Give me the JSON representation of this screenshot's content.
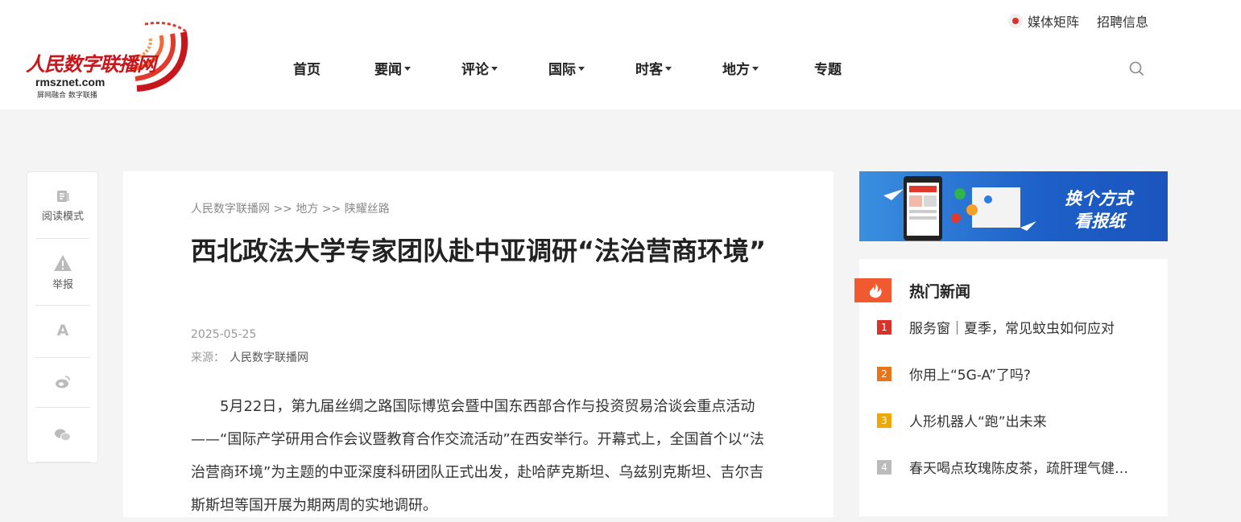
{
  "site": {
    "logo_cn": "人民数字联播网",
    "logo_en": "rmsznet.com",
    "logo_slogan": "屏网融合 数字联播"
  },
  "toplinks": {
    "media": "媒体矩阵",
    "jobs": "招聘信息"
  },
  "nav": {
    "items": [
      {
        "label": "首页",
        "has_dropdown": false
      },
      {
        "label": "要闻",
        "has_dropdown": true
      },
      {
        "label": "评论",
        "has_dropdown": true
      },
      {
        "label": "国际",
        "has_dropdown": true
      },
      {
        "label": "时客",
        "has_dropdown": true
      },
      {
        "label": "地方",
        "has_dropdown": true
      },
      {
        "label": "专题",
        "has_dropdown": false
      }
    ]
  },
  "sidebar": {
    "reading_mode": "阅读模式",
    "report": "举报",
    "font": "A"
  },
  "article": {
    "breadcrumb": "人民数字联播网 >> 地方 >> 陕耀丝路",
    "title": "西北政法大学专家团队赴中亚调研“法治营商环境”",
    "date": "2025-05-25",
    "source_label": "来源：",
    "source_value": "人民数字联播网",
    "body": "5月22日，第九届丝绸之路国际博览会暨中国东西部合作与投资贸易洽谈会重点活动——“国际产学研用合作会议暨教育合作交流活动”在西安举行。开幕式上，全国首个以“法治营商环境”为主题的中亚深度科研团队正式出发，赴哈萨克斯坦、乌兹别克斯坦、吉尔吉斯斯坦等国开展为期两周的实地调研。"
  },
  "banner": {
    "line1": "换个方式",
    "line2": "看报纸"
  },
  "hot": {
    "title": "热门新闻",
    "items": [
      {
        "rank": "1",
        "text": "服务窗｜夏季，常见蚊虫如何应对",
        "color": "#d9322b"
      },
      {
        "rank": "2",
        "text": "你用上“5G-A”了吗?",
        "color": "#e8751a"
      },
      {
        "rank": "3",
        "text": "人形机器人“跑”出未来",
        "color": "#f0a800"
      },
      {
        "rank": "4",
        "text": "春天喝点玫瑰陈皮茶，疏肝理气健…",
        "color": "#bbbbbb"
      }
    ]
  },
  "colors": {
    "brand_red": "#c8161d",
    "hot_flag": "#f15a31",
    "page_bg": "#f4f4f4"
  }
}
